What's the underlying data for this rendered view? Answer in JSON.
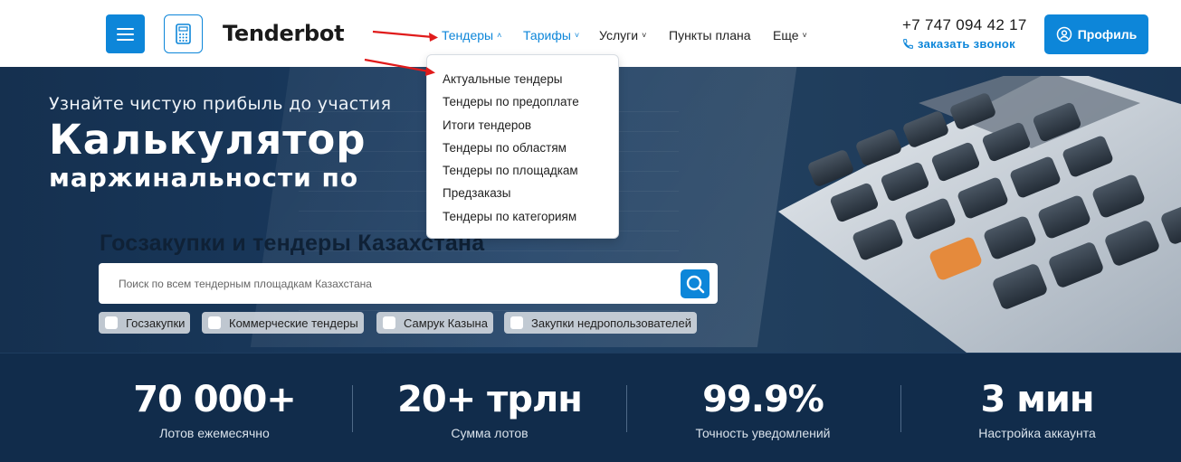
{
  "header": {
    "logo_text": "Tenderbot",
    "nav": [
      {
        "label": "Тендеры",
        "caret": "˄",
        "active": true
      },
      {
        "label": "Тарифы",
        "caret": "˅",
        "active": true
      },
      {
        "label": "Услуги",
        "caret": "˅",
        "active": false
      },
      {
        "label": "Пункты плана",
        "caret": "",
        "active": false
      },
      {
        "label": "Еще",
        "caret": "˅",
        "active": false
      }
    ],
    "phone": "+7 747 094 42 17",
    "callback_label": "заказать звонок",
    "profile_label": "Профиль"
  },
  "dropdown": {
    "items": [
      "Актуальные тендеры",
      "Тендеры по предоплате",
      "Итоги тендеров",
      "Тендеры по областям",
      "Тендеры по площадкам",
      "Предзаказы",
      "Тендеры по категориям"
    ]
  },
  "hero": {
    "tagline": "Узнайте чистую прибыль до участия",
    "headline_1": "Калькулятор",
    "headline_2": "маржинальности по",
    "search_title": "Госзакупки и тендеры Казахстана",
    "search_placeholder": "Поиск по всем тендерным площадкам Казахстана",
    "filters": [
      "Госзакупки",
      "Коммерческие тендеры",
      "Самрук Казына",
      "Закупки недропользователей"
    ]
  },
  "stats": [
    {
      "value": "70 000+",
      "label": "Лотов ежемесячно"
    },
    {
      "value": "20+ трлн",
      "label": "Сумма лотов"
    },
    {
      "value": "99.9%",
      "label": "Точность уведомлений"
    },
    {
      "value": "3 мин",
      "label": "Настройка аккаунта"
    }
  ],
  "colors": {
    "accent": "#0d86d9",
    "annotation_arrow": "#e01b1b",
    "stats_bg": "#112c4b"
  }
}
